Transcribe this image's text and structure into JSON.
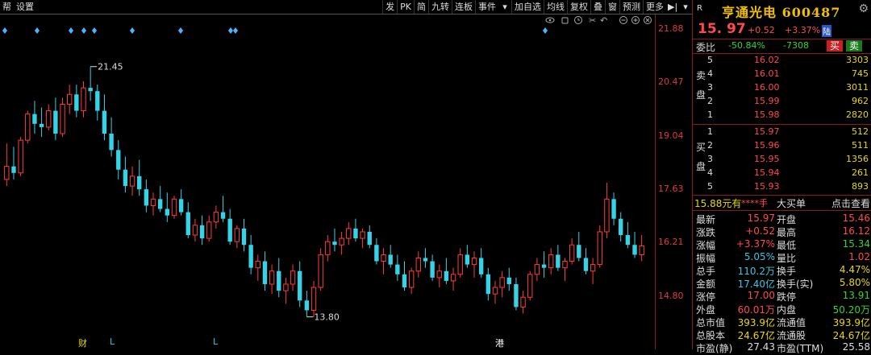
{
  "toolbar": {
    "left": [
      "帮",
      "设置"
    ],
    "right": [
      "发",
      "PK",
      "简",
      "九转",
      "连板",
      "事件",
      "加自选",
      "均线",
      "复权",
      "叠",
      "窗",
      "预测",
      "更多"
    ]
  },
  "chart_data": {
    "type": "candlestick",
    "y_ticks": [
      "21.88",
      "20.47",
      "19.04",
      "17.63",
      "16.21",
      "14.80"
    ],
    "ylim": [
      13.2,
      22.6
    ],
    "annotations": [
      {
        "label": "21.45",
        "value": 21.45
      },
      {
        "label": "13.80",
        "value": 13.8
      }
    ],
    "bottom_markers": [
      {
        "label": "财",
        "color": "#e8d800"
      },
      {
        "label": "L",
        "color": "#3ac6e0"
      },
      {
        "label": "L",
        "color": "#3ac6e0"
      },
      {
        "label": "港",
        "color": "#ffffff"
      }
    ],
    "candles": [
      [
        18.0,
        19.1,
        17.8,
        18.4
      ],
      [
        18.4,
        19.0,
        18.0,
        18.2
      ],
      [
        18.2,
        19.3,
        18.1,
        19.2
      ],
      [
        19.2,
        20.1,
        19.1,
        20.0
      ],
      [
        20.0,
        20.4,
        19.4,
        19.7
      ],
      [
        19.7,
        20.2,
        19.3,
        19.6
      ],
      [
        19.6,
        20.3,
        19.5,
        20.1
      ],
      [
        20.1,
        20.5,
        19.2,
        19.4
      ],
      [
        19.4,
        20.5,
        19.3,
        20.3
      ],
      [
        20.3,
        20.9,
        20.0,
        20.6
      ],
      [
        20.6,
        20.9,
        19.9,
        20.1
      ],
      [
        20.1,
        21.0,
        19.9,
        20.8
      ],
      [
        20.8,
        21.45,
        20.4,
        20.7
      ],
      [
        20.7,
        20.9,
        19.8,
        20.1
      ],
      [
        20.1,
        20.6,
        19.2,
        19.4
      ],
      [
        19.4,
        19.9,
        18.7,
        18.9
      ],
      [
        18.9,
        19.2,
        18.0,
        18.3
      ],
      [
        18.3,
        18.7,
        17.6,
        17.8
      ],
      [
        17.8,
        18.4,
        17.5,
        18.1
      ],
      [
        18.1,
        18.6,
        17.5,
        17.7
      ],
      [
        17.7,
        18.0,
        17.0,
        17.2
      ],
      [
        17.2,
        17.6,
        16.9,
        17.4
      ],
      [
        17.4,
        17.8,
        17.0,
        17.1
      ],
      [
        17.1,
        17.6,
        16.7,
        16.9
      ],
      [
        16.9,
        17.5,
        16.8,
        17.4
      ],
      [
        17.4,
        17.7,
        16.9,
        17.0
      ],
      [
        17.0,
        17.3,
        16.2,
        16.3
      ],
      [
        16.3,
        16.8,
        16.1,
        16.6
      ],
      [
        16.6,
        16.9,
        16.0,
        16.2
      ],
      [
        16.2,
        16.9,
        16.1,
        16.7
      ],
      [
        16.7,
        17.2,
        16.5,
        17.0
      ],
      [
        17.0,
        17.5,
        16.7,
        16.8
      ],
      [
        16.8,
        17.1,
        16.0,
        16.1
      ],
      [
        16.1,
        16.6,
        15.9,
        16.5
      ],
      [
        16.5,
        16.8,
        15.8,
        16.0
      ],
      [
        16.0,
        16.3,
        15.1,
        15.3
      ],
      [
        15.3,
        15.7,
        14.9,
        15.5
      ],
      [
        15.5,
        15.8,
        14.6,
        14.8
      ],
      [
        14.8,
        15.4,
        14.5,
        15.2
      ],
      [
        15.2,
        15.6,
        14.4,
        14.6
      ],
      [
        14.6,
        15.0,
        14.2,
        14.8
      ],
      [
        14.8,
        15.4,
        14.6,
        15.2
      ],
      [
        15.2,
        15.5,
        14.1,
        14.3
      ],
      [
        14.3,
        14.6,
        13.8,
        14.0
      ],
      [
        14.0,
        14.9,
        13.8,
        14.7
      ],
      [
        14.7,
        15.9,
        14.6,
        15.7
      ],
      [
        15.7,
        16.3,
        15.5,
        16.1
      ],
      [
        16.1,
        16.5,
        15.8,
        16.0
      ],
      [
        16.0,
        16.4,
        15.7,
        16.2
      ],
      [
        16.2,
        16.7,
        16.0,
        16.5
      ],
      [
        16.5,
        16.8,
        16.1,
        16.2
      ],
      [
        16.2,
        16.5,
        15.9,
        16.4
      ],
      [
        16.4,
        16.6,
        15.9,
        16.0
      ],
      [
        16.0,
        16.2,
        15.4,
        15.5
      ],
      [
        15.5,
        15.9,
        15.1,
        15.7
      ],
      [
        15.7,
        16.0,
        15.3,
        15.4
      ],
      [
        15.4,
        15.7,
        14.9,
        15.1
      ],
      [
        15.1,
        15.5,
        14.6,
        14.7
      ],
      [
        14.7,
        15.3,
        14.5,
        15.2
      ],
      [
        15.2,
        15.8,
        15.0,
        15.6
      ],
      [
        15.6,
        15.9,
        15.3,
        15.5
      ],
      [
        15.5,
        15.7,
        14.9,
        15.0
      ],
      [
        15.0,
        15.4,
        14.7,
        15.2
      ],
      [
        15.2,
        15.6,
        14.8,
        14.9
      ],
      [
        14.9,
        15.3,
        14.6,
        15.1
      ],
      [
        15.1,
        15.9,
        15.0,
        15.7
      ],
      [
        15.7,
        16.0,
        15.3,
        15.4
      ],
      [
        15.4,
        15.8,
        15.0,
        15.6
      ],
      [
        15.6,
        15.9,
        15.0,
        15.1
      ],
      [
        15.1,
        15.3,
        14.3,
        14.5
      ],
      [
        14.5,
        14.9,
        14.2,
        14.7
      ],
      [
        14.7,
        15.2,
        14.4,
        15.0
      ],
      [
        15.0,
        15.3,
        14.6,
        14.8
      ],
      [
        14.8,
        15.0,
        14.0,
        14.1
      ],
      [
        14.1,
        14.6,
        13.9,
        14.4
      ],
      [
        14.4,
        15.2,
        14.3,
        15.1
      ],
      [
        15.1,
        15.6,
        14.9,
        15.4
      ],
      [
        15.4,
        15.8,
        15.0,
        15.3
      ],
      [
        15.3,
        15.9,
        15.1,
        15.7
      ],
      [
        15.7,
        16.0,
        15.2,
        15.3
      ],
      [
        15.3,
        15.6,
        14.9,
        15.5
      ],
      [
        15.5,
        16.2,
        15.4,
        16.0
      ],
      [
        16.0,
        16.4,
        15.5,
        15.6
      ],
      [
        15.6,
        15.9,
        15.1,
        15.2
      ],
      [
        15.2,
        15.6,
        14.8,
        15.4
      ],
      [
        15.4,
        16.6,
        15.3,
        16.4
      ],
      [
        16.4,
        17.9,
        16.2,
        17.4
      ],
      [
        17.4,
        17.6,
        16.6,
        16.8
      ],
      [
        16.8,
        17.0,
        16.1,
        16.3
      ],
      [
        16.3,
        16.7,
        15.9,
        16.0
      ],
      [
        16.0,
        16.4,
        15.6,
        15.7
      ],
      [
        15.7,
        16.3,
        15.5,
        15.97
      ]
    ]
  },
  "quote": {
    "r_label": "R",
    "name": "亨通光电",
    "code": "600487",
    "price": "15. 97",
    "change": "+0.52",
    "change_pct": "+3.37%",
    "lu_tag": "陆",
    "weibi_label": "委比",
    "weibi": "-50.84%",
    "weicha": "-7308",
    "buy_btn": "买",
    "sell_btn": "卖"
  },
  "asks": [
    {
      "level": "5",
      "price": "16.02",
      "vol": "3303"
    },
    {
      "level": "4",
      "price": "16.01",
      "vol": "745"
    },
    {
      "level": "3",
      "price": "16.00",
      "vol": "3011"
    },
    {
      "level": "2",
      "price": "15.99",
      "vol": "962"
    },
    {
      "level": "1",
      "price": "15.98",
      "vol": "2820"
    }
  ],
  "bids": [
    {
      "level": "1",
      "price": "15.97",
      "vol": "512"
    },
    {
      "level": "2",
      "price": "15.96",
      "vol": "511"
    },
    {
      "level": "3",
      "price": "15.95",
      "vol": "1356"
    },
    {
      "level": "4",
      "price": "15.94",
      "vol": "261"
    },
    {
      "level": "5",
      "price": "15.93",
      "vol": "893"
    }
  ],
  "ask_side_label": [
    "卖",
    "盘"
  ],
  "bid_side_label": [
    "买",
    "盘"
  ],
  "big_order": {
    "price": "15.88元有",
    "hands": "****手",
    "big": "大买单",
    "link": "点击查看"
  },
  "stats": [
    {
      "k": "最新",
      "v": "15.97",
      "vc": "red",
      "k2": "开盘",
      "v2": "15.46",
      "v2c": "red"
    },
    {
      "k": "涨跌",
      "v": "+0.52",
      "vc": "red",
      "k2": "最高",
      "v2": "16.12",
      "v2c": "red"
    },
    {
      "k": "涨幅",
      "v": "+3.37%",
      "vc": "red",
      "k2": "最低",
      "v2": "15.34",
      "v2c": "green"
    },
    {
      "k": "振幅",
      "v": "5.05%",
      "vc": "cyan",
      "k2": "量比",
      "v2": "1.02",
      "v2c": "red"
    },
    {
      "k": "总手",
      "v": "110.2万",
      "vc": "cyan",
      "k2": "换手",
      "v2": "4.47%",
      "v2c": "yel"
    },
    {
      "k": "金额",
      "v": "17.40亿",
      "vc": "cyan",
      "k2": "换手(实)",
      "v2": "5.80%",
      "v2c": "yel"
    },
    {
      "k": "涨停",
      "v": "17.00",
      "vc": "red",
      "k2": "跌停",
      "v2": "13.91",
      "v2c": "green"
    },
    {
      "k": "外盘",
      "v": "60.01万",
      "vc": "red",
      "k2": "内盘",
      "v2": "50.20万",
      "v2c": "green"
    },
    {
      "k": "总市值",
      "v": "393.9亿",
      "vc": "yel",
      "k2": "流通值",
      "v2": "393.9亿",
      "v2c": "yel"
    },
    {
      "k": "总股本",
      "v": "24.67亿",
      "vc": "yel",
      "k2": "流通股",
      "v2": "24.67亿",
      "v2c": "yel"
    },
    {
      "k": "市盈(静)",
      "v": "27.43",
      "vc": "white",
      "k2": "市盈(TTM)",
      "v2": "25.58",
      "v2c": "white"
    }
  ]
}
